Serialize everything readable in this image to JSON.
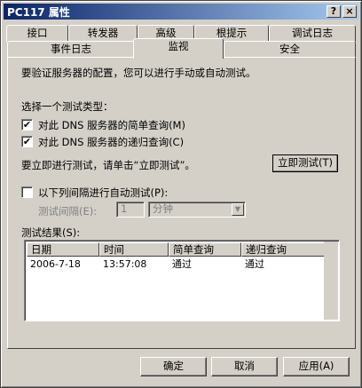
{
  "window": {
    "title": "PC117 属性",
    "help_button": "?",
    "close_button": "×"
  },
  "tabs_back": [
    "接口",
    "转发器",
    "高级",
    "根提示",
    "调试日志"
  ],
  "tabs_front": [
    "事件日志",
    "监视",
    "安全"
  ],
  "intro_text": "要验证服务器的配置，您可以进行手动或自动测试。",
  "test_type_label": "选择一个测试类型：",
  "simple_query": {
    "label": "对此 DNS 服务器的简单查询(M)",
    "checked": true
  },
  "recursive_query": {
    "label": "对此 DNS 服务器的递归查询(C)",
    "checked": true
  },
  "test_now_prompt": "要立即进行测试，请单击“立即测试”。",
  "test_now_button": "立即测试(T)",
  "auto_test": {
    "label": "以下列间隔进行自动测试(P):",
    "checked": false
  },
  "interval_label": "测试间隔(E):",
  "interval_value": "1",
  "interval_unit": "分钟",
  "results_label": "测试结果(S):",
  "results": {
    "columns": [
      "日期",
      "时间",
      "简单查询",
      "递归查询"
    ],
    "rows": [
      [
        "2006-7-18",
        "13:57:08",
        "通过",
        "通过"
      ]
    ]
  },
  "buttons": {
    "ok": "确定",
    "cancel": "取消",
    "apply": "应用(A)"
  },
  "colors": {
    "title_start": "#0a246a",
    "title_end": "#a6caf0",
    "face": "#d4d0c8"
  }
}
